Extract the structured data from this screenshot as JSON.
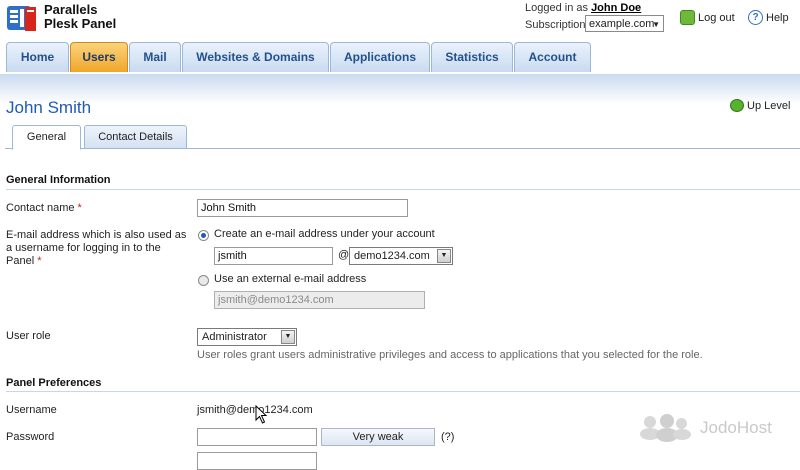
{
  "header": {
    "brand_line1": "Parallels",
    "brand_line2": "Plesk Panel",
    "logged_in_prefix": "Logged in as",
    "logged_in_user": "John Doe",
    "subscription_label": "Subscription",
    "subscription_value": "example.com",
    "logout_label": "Log out",
    "help_label": "Help"
  },
  "nav": {
    "tabs": [
      "Home",
      "Users",
      "Mail",
      "Websites & Domains",
      "Applications",
      "Statistics",
      "Account"
    ],
    "active": "Users"
  },
  "page": {
    "title": "John Smith",
    "up_level": "Up Level",
    "subtabs": [
      "General",
      "Contact Details"
    ]
  },
  "general": {
    "section_title": "General Information",
    "contact_name_label": "Contact name",
    "contact_name_value": "John Smith",
    "email_label": "E-mail address which is also used as a username for logging in to the Panel",
    "email_option_create": "Create an e-mail address under your account",
    "email_local_part": "jsmith",
    "at_sign": "@",
    "email_domain": "demo1234.com",
    "email_option_external": "Use an external e-mail address",
    "external_placeholder": "jsmith@demo1234.com",
    "role_label": "User role",
    "role_value": "Administrator",
    "role_hint": "User roles grant users administrative privileges and access to applications that you selected for the role."
  },
  "prefs": {
    "section_title": "Panel Preferences",
    "username_label": "Username",
    "username_value": "jsmith@demo1234.com",
    "password_label": "Password",
    "strength_label": "Very weak",
    "help_hint": "(?)"
  },
  "watermark": {
    "text": "JodoHost"
  },
  "colors": {
    "accent": "#1f5ab8",
    "active_tab": "#f0a62c",
    "required": "#c2261f"
  }
}
